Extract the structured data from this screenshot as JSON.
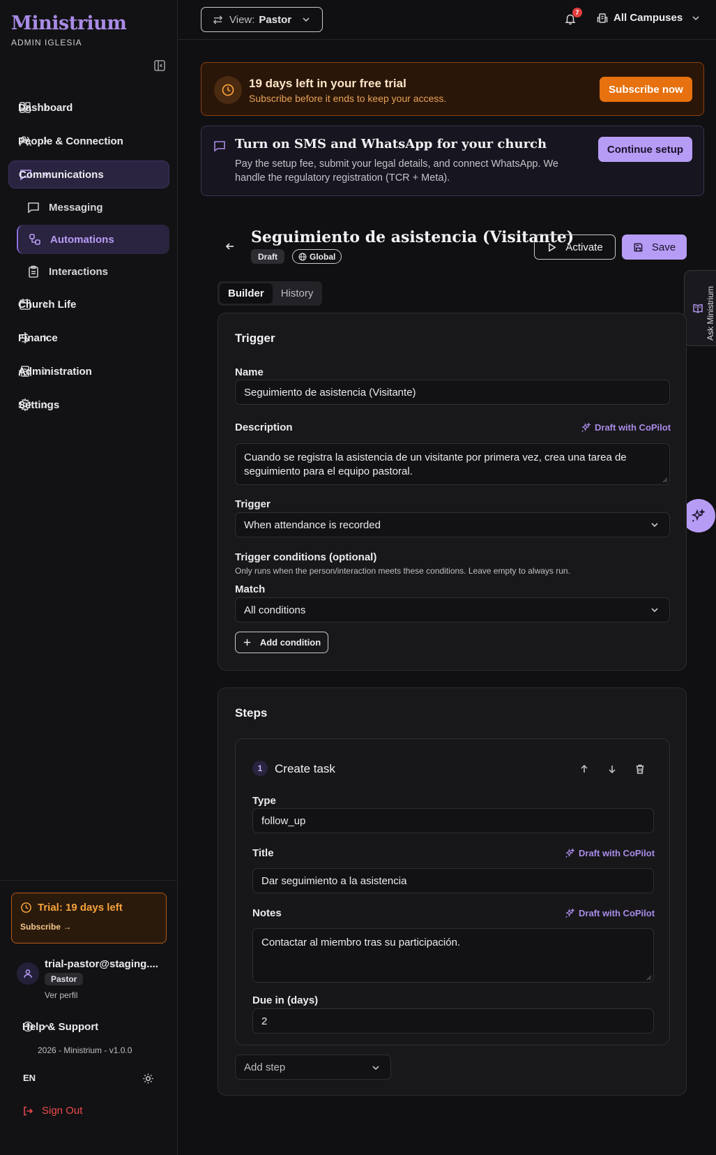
{
  "sidebar": {
    "brand": "Ministrium",
    "brand_sub": "ADMIN IGLESIA",
    "nav": [
      {
        "label": "Dashboard",
        "icon": "dashboard-icon"
      },
      {
        "label": "People & Connection",
        "icon": "people-icon"
      },
      {
        "label": "Communications",
        "icon": "chat-icon",
        "active": true
      },
      {
        "label": "Church Life",
        "icon": "calendar-icon"
      },
      {
        "label": "Finance",
        "icon": "dollar-icon"
      },
      {
        "label": "Administration",
        "icon": "building-icon"
      },
      {
        "label": "Settings",
        "icon": "gear-icon"
      }
    ],
    "sub": [
      {
        "label": "Messaging",
        "icon": "message-icon"
      },
      {
        "label": "Automations",
        "icon": "workflow-icon",
        "active": true
      },
      {
        "label": "Interactions",
        "icon": "clipboard-icon"
      }
    ],
    "trial": {
      "title": "Trial: 19 days left",
      "cta": "Subscribe →"
    },
    "user": {
      "email": "trial-pastor@staging....",
      "role": "Pastor",
      "profile": "Ver perfil"
    },
    "help": "Help & Support",
    "version": "2026 - Ministrium - v1.0.0",
    "lang": "EN",
    "signout": "Sign Out"
  },
  "topbar": {
    "view_key": "View:",
    "view_value": "Pastor",
    "notifications": "7",
    "campus": "All Campuses"
  },
  "banners": {
    "trial_title": "19 days left in your free trial",
    "trial_sub": "Subscribe before it ends to keep your access.",
    "trial_btn": "Subscribe now",
    "sms_title": "Turn on SMS and WhatsApp for your church",
    "sms_sub": "Pay the setup fee, submit your legal details, and connect WhatsApp. We handle the regulatory registration (TCR + Meta).",
    "sms_btn": "Continue setup"
  },
  "header": {
    "title": "Seguimiento de asistencia (Visitante)",
    "status": "Draft",
    "scope": "Global",
    "activate": "Activate",
    "save": "Save"
  },
  "tabs": [
    "Builder",
    "History"
  ],
  "ask": "Ask Ministrium",
  "trigger": {
    "heading": "Trigger",
    "name_label": "Name",
    "name_value": "Seguimiento de asistencia (Visitante)",
    "desc_label": "Description",
    "copilot": "Draft with CoPilot",
    "desc_value": "Cuando se registra la asistencia de un visitante por primera vez, crea una tarea de seguimiento para el equipo pastoral.",
    "trigger_label": "Trigger",
    "trigger_value": "When attendance is recorded",
    "cond_label": "Trigger conditions (optional)",
    "cond_hint": "Only runs when the person/interaction meets these conditions. Leave empty to always run.",
    "match_label": "Match",
    "match_value": "All conditions",
    "add_condition": "Add condition"
  },
  "steps": {
    "heading": "Steps",
    "step": {
      "number": "1",
      "title": "Create task",
      "type_label": "Type",
      "type_value": "follow_up",
      "title_label": "Title",
      "title_value": "Dar seguimiento a la asistencia",
      "notes_label": "Notes",
      "notes_value": "Contactar al miembro tras su participación.",
      "due_label": "Due in (days)",
      "due_value": "2"
    },
    "add_step": "Add step"
  },
  "colors": {
    "accent": "#b79cf5",
    "orange": "#e7710f",
    "bg": "#101012"
  }
}
